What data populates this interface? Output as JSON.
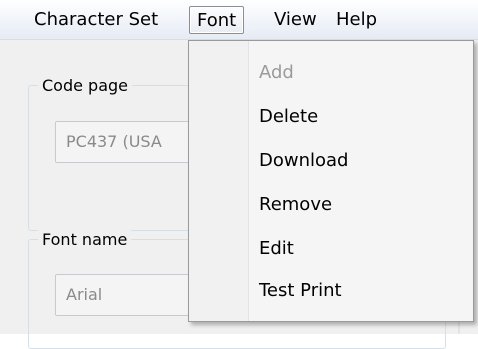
{
  "menubar": {
    "items": [
      {
        "label": "Character Set"
      },
      {
        "label": "Font",
        "open": true
      },
      {
        "label": "View"
      },
      {
        "label": "Help"
      }
    ]
  },
  "code_page": {
    "label": "Code page",
    "value": "PC437 (USA"
  },
  "font_name": {
    "label": "Font name",
    "value": "Arial"
  },
  "font_menu": {
    "items": [
      {
        "label": "Add",
        "disabled": true
      },
      {
        "label": "Delete",
        "disabled": false
      },
      {
        "label": "Download",
        "disabled": false
      },
      {
        "label": "Remove",
        "disabled": false
      },
      {
        "label": "Edit",
        "disabled": false
      },
      {
        "label": "Test Print",
        "disabled": false
      }
    ]
  }
}
